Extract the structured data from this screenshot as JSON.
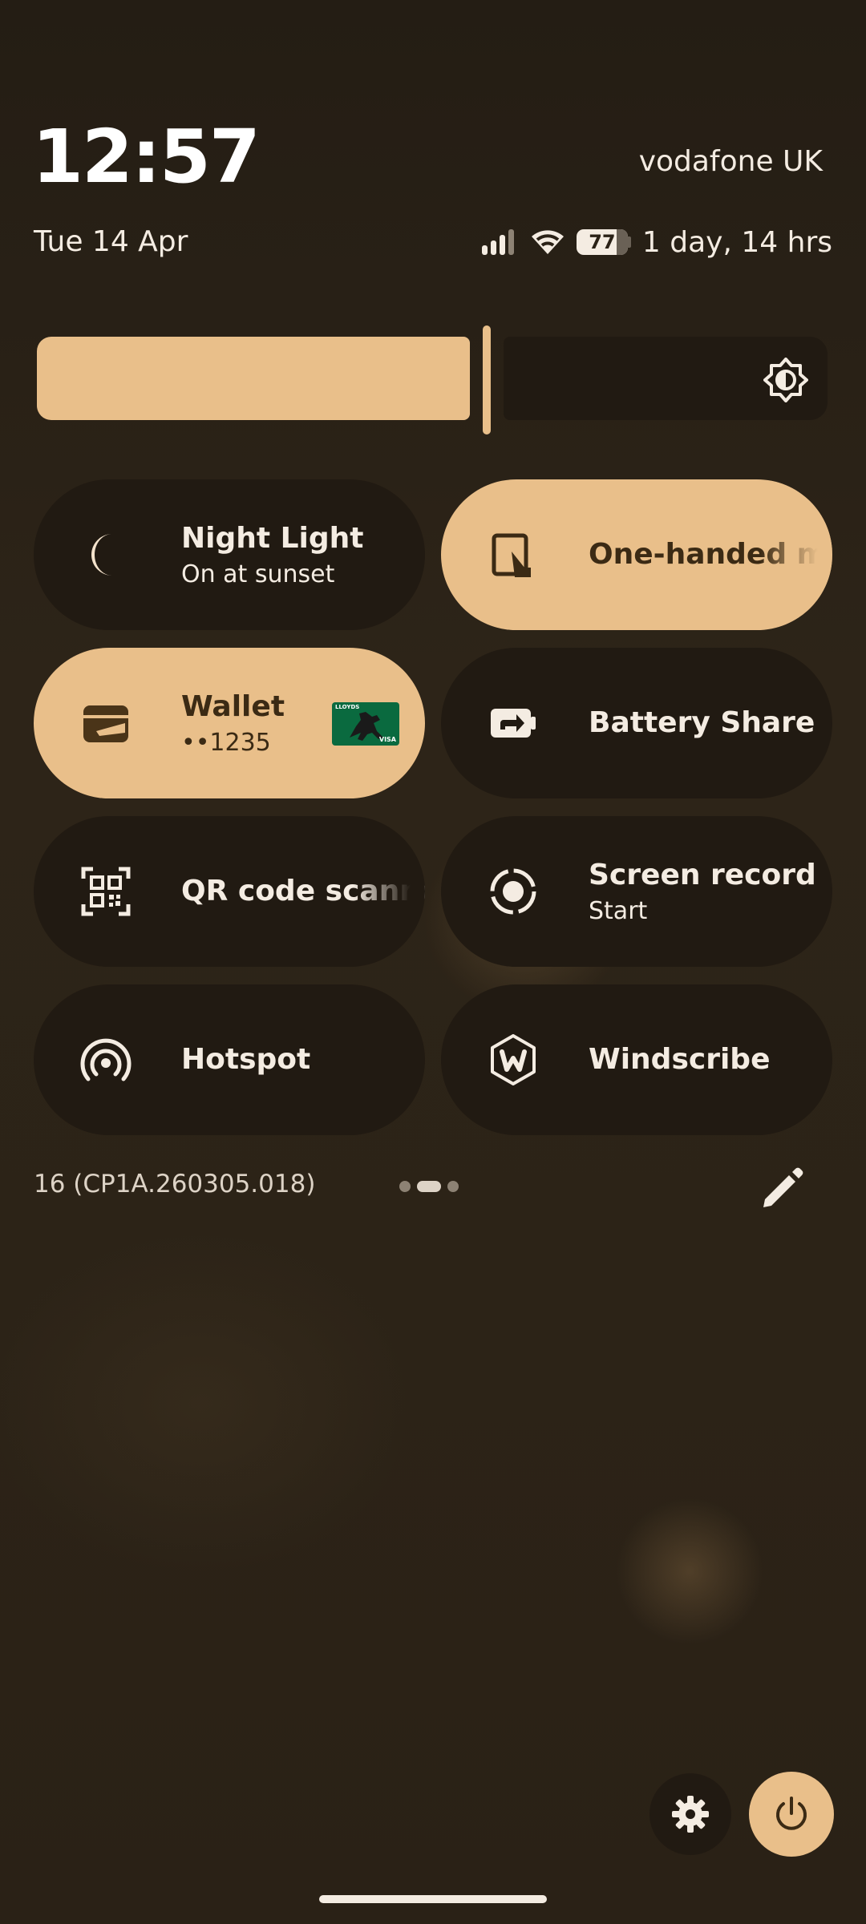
{
  "status": {
    "time": "12:57",
    "date": "Tue 14 Apr",
    "carrier": "vodafone UK",
    "battery_percent": "77",
    "battery_remaining": "1 day, 14 hrs",
    "signal_icon": "cellular-signal-icon",
    "wifi_icon": "wifi-icon"
  },
  "brightness": {
    "level_fraction": 0.55,
    "icon": "brightness-icon"
  },
  "tiles": [
    {
      "label": "Night Light",
      "sub": "On at sunset",
      "icon": "moon-icon",
      "active": false
    },
    {
      "label": "One-handed mode",
      "icon": "one-handed-mode-icon",
      "active": true
    },
    {
      "label": "Wallet",
      "sub": "••1235",
      "icon": "wallet-icon",
      "active": true,
      "card_bank": "LLOYDS",
      "card_network": "VISA"
    },
    {
      "label": "Battery Share",
      "icon": "battery-share-icon",
      "active": false
    },
    {
      "label": "QR code scanner",
      "icon": "qr-code-icon",
      "active": false
    },
    {
      "label": "Screen record",
      "sub": "Start",
      "icon": "screen-record-icon",
      "active": false
    },
    {
      "label": "Hotspot",
      "icon": "hotspot-icon",
      "active": false
    },
    {
      "label": "Windscribe",
      "icon": "windscribe-icon",
      "active": false
    }
  ],
  "footer": {
    "build": "16 (CP1A.260305.018)",
    "page_count": 3,
    "current_page": 2
  },
  "colors": {
    "accent": "#e9bf8a",
    "tile_off": "#211a12",
    "background": "#2a2116"
  }
}
